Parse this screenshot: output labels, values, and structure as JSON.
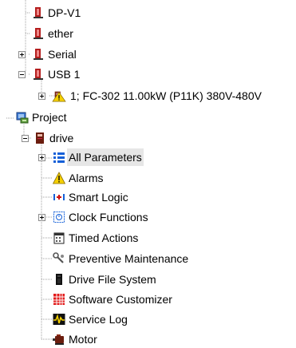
{
  "tree": {
    "dp_v1": "DP-V1",
    "ether": "ether",
    "serial": "Serial",
    "usb1": "USB 1",
    "drive_device": "1; FC-302 11.00kW (P11K) 380V-480V",
    "project": "Project",
    "drive": "drive",
    "items": [
      "All Parameters",
      "Alarms",
      "Smart Logic",
      "Clock Functions",
      "Timed Actions",
      "Preventive Maintenance",
      "Drive File System",
      "Software Customizer",
      "Service Log",
      "Motor"
    ]
  },
  "colors": {
    "connector_red": "#b51e1e",
    "list_blue": "#1560d8",
    "warning_yellow": "#f5d000",
    "selection": "#e6e6e6"
  }
}
